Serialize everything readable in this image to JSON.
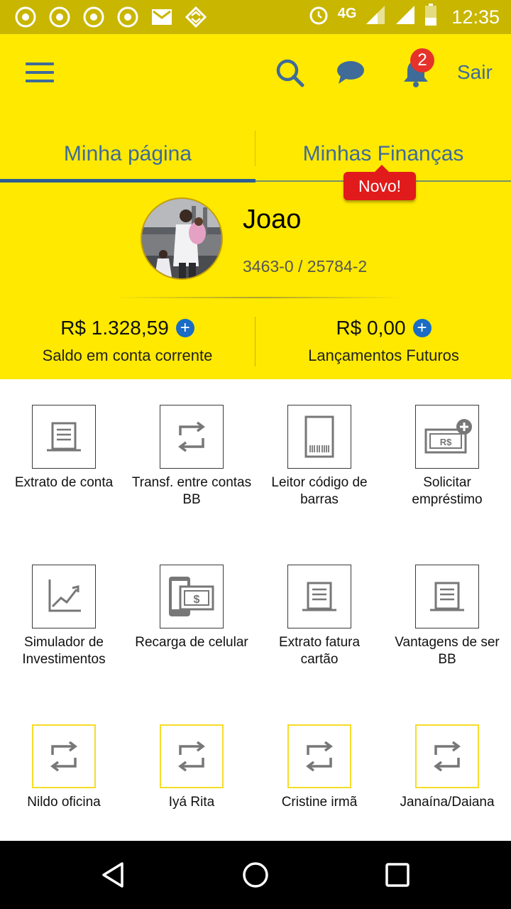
{
  "status_bar": {
    "network": "4G",
    "time": "12:35"
  },
  "header": {
    "logout_label": "Sair",
    "notification_count": "2"
  },
  "tabs": [
    {
      "label": "Minha página",
      "active": true
    },
    {
      "label": "Minhas Finanças",
      "active": false
    }
  ],
  "new_badge": "Novo!",
  "profile": {
    "name": "Joao",
    "account": "3463-0 / 25784-2"
  },
  "balances": [
    {
      "amount": "R$ 1.328,59",
      "label": "Saldo em conta corrente"
    },
    {
      "amount": "R$ 0,00",
      "label": "Lançamentos Futuros"
    }
  ],
  "shortcuts": [
    {
      "label": "Extrato de conta",
      "icon": "statement-icon"
    },
    {
      "label": "Transf. entre contas BB",
      "icon": "transfer-icon"
    },
    {
      "label": "Leitor código de barras",
      "icon": "barcode-icon"
    },
    {
      "label": "Solicitar empréstimo",
      "icon": "loan-icon"
    },
    {
      "label": "Simulador de Investimentos",
      "icon": "chart-icon"
    },
    {
      "label": "Recarga de celular",
      "icon": "phone-recharge-icon"
    },
    {
      "label": "Extrato fatura cartão",
      "icon": "statement-icon"
    },
    {
      "label": "Vantagens de ser BB",
      "icon": "statement-icon"
    },
    {
      "label": "Nildo oficina",
      "icon": "transfer-icon"
    },
    {
      "label": "Iyá Rita",
      "icon": "transfer-icon"
    },
    {
      "label": "Cristine irmã",
      "icon": "transfer-icon"
    },
    {
      "label": "Janaína/Daiana",
      "icon": "transfer-icon"
    }
  ],
  "colors": {
    "brand_yellow": "#ffe901",
    "brand_blue": "#3f6b99",
    "badge_red": "#e5322b",
    "favorite_border": "#f5dc2a"
  }
}
